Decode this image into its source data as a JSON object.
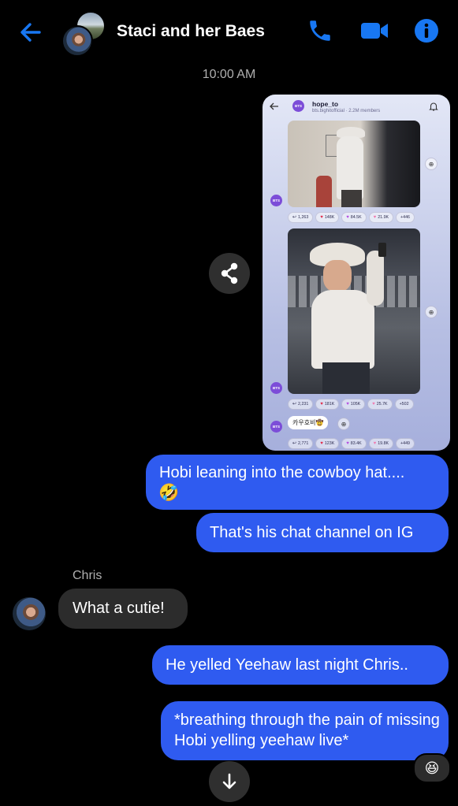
{
  "header": {
    "title": "Staci and her Baes",
    "back_icon": "arrow-left-icon",
    "call_icon": "phone-icon",
    "video_icon": "video-camera-icon",
    "info_icon": "info-icon",
    "accent": "#1877f2"
  },
  "timestamp": "10:00 AM",
  "shared_screenshot": {
    "channel_name": "hope_to",
    "channel_sub": "bts.bighitofficial · 2.2M members",
    "avatar_text": "BTS",
    "post1_reactions": [
      "1,263",
      "148K",
      "84.5K",
      "21.9K",
      "+446"
    ],
    "post2_reactions": [
      "2,231",
      "181K",
      "105K",
      "25.7K",
      "+502"
    ],
    "post3_text": "카우호비🤠",
    "post3_reactions": [
      "2,771",
      "123K",
      "83.4K",
      "19.8K",
      "+449"
    ]
  },
  "messages": [
    {
      "id": "m1",
      "text": "Hobi leaning into the cowboy hat....",
      "emoji": "🤣",
      "from": "me"
    },
    {
      "id": "m2",
      "text": "That's his chat channel on IG",
      "from": "me"
    },
    {
      "id": "m3",
      "sender": "Chris",
      "text": "What a cutie!",
      "from": "other"
    },
    {
      "id": "m4",
      "text": "He yelled Yeehaw last night Chris..",
      "from": "me"
    },
    {
      "id": "m5",
      "text": "*breathing through the pain of missing Hobi yelling yeehaw live*",
      "from": "me",
      "reaction": "😆"
    }
  ],
  "colors": {
    "outgoing_bubble": "#2f5bf0",
    "incoming_bubble": "#2c2c2c",
    "background": "#000000"
  }
}
